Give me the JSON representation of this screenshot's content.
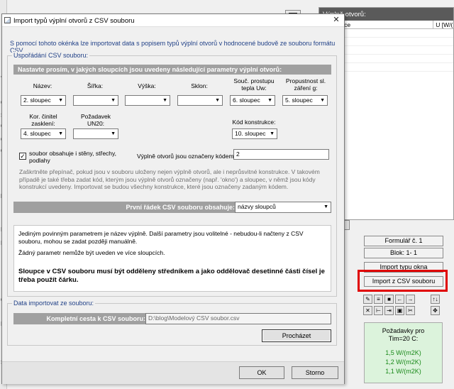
{
  "background": {
    "left_strip_chars": [
      "J",
      "C",
      "S",
      "C",
      "C",
      "C",
      "F",
      "I",
      "I",
      "C",
      "I",
      "S"
    ],
    "right_panel": {
      "title": "Výplně otvorů:",
      "col1": "konstrukce",
      "col2": "U [W/("
    },
    "side_buttons": {
      "formular": "Formulář č. 1",
      "blok": "Blok: 1- 1",
      "import_typu": "Import typu okna",
      "import_csv": "Import z CSV souboru"
    },
    "tools": {
      "row1": [
        "✎",
        "≡",
        "■",
        "←",
        "→",
        "↑↓"
      ],
      "row2": [
        "✕",
        "⊢",
        "⇥",
        "▣",
        "✂",
        "✥"
      ]
    },
    "requirements": {
      "title_line1": "Požadavky pro",
      "title_line2": "Tim=20 C:",
      "values": [
        "1,5 W/(m2K)",
        "1,2 W/(m2K)",
        "1,1 W/(m2K)"
      ],
      "value_color": "#1a8a1a"
    },
    "highlight_color": "#e00000"
  },
  "dialog": {
    "title": "Import typů výplní otvorů z CSV souboru",
    "close_icon": "✕",
    "intro": "S pomocí tohoto okénka lze importovat data s popisem typů výplní otvorů v hodnocené budově ze souboru formátu CSV.",
    "layout_group": {
      "legend": "Uspořádání CSV souboru:",
      "header": "Nastavte prosím, v jakých sloupcích jsou uvedeny následující parametry výplní otvorů:",
      "fields": {
        "nazev": {
          "label": "Název:",
          "value": "2. sloupec"
        },
        "sirka": {
          "label": "Šířka:",
          "value": ""
        },
        "vyska": {
          "label": "Výška:",
          "value": ""
        },
        "sklon": {
          "label": "Sklon:",
          "value": ""
        },
        "uw": {
          "label": "Souč. prostupu tepla Uw:",
          "value": "6. sloupec"
        },
        "g": {
          "label": "Propustnost sl. záření g:",
          "value": "5. sloupec"
        },
        "zaskleni": {
          "label": "Kor. činitel zasklení:",
          "value": "4. sloupec"
        },
        "un20": {
          "label": "Požadavek UN20:",
          "value": ""
        },
        "kod": {
          "label": "Kód konstrukce:",
          "value": "10. sloupec"
        }
      },
      "checkbox_label": "soubor obsahuje i stěny, střechy, podlahy",
      "checkbox_mark": "✓",
      "code_label": "Výplně otvorů jsou označeny kódem:",
      "code_value": "2",
      "gray_note": "Zaškrtněte přepínač, pokud jsou v souboru uloženy nejen výplně otvorů, ale i neprůsvitné konstrukce. V takovém případě je také třeba zadat kód, kterým jsou výplně otvorů označeny (např. 'okno') a sloupec, v němž jsou kódy konstrukcí uvedeny. Importovat se budou všechny konstrukce, které jsou označeny zadaným kódem.",
      "first_row_label": "První řádek CSV souboru obsahuje:",
      "first_row_value": "názvy sloupců",
      "info1": "Jediným povinným parametrem je název výplně. Další parametry jsou volitelné - nebudou-li načteny z CSV souboru, mohou se zadat později manuálně.",
      "info2": "Žádný parametr nemůže být uveden ve více sloupcích.",
      "warning": "Sloupce v CSV souboru musí být odděleny středníkem a jako oddělovač desetinné části čísel je třeba použít čárku."
    },
    "file_group": {
      "legend": "Data importovat ze souboru:",
      "path_label": "Kompletní cesta k CSV souboru:",
      "path_value": "D:\\blog\\Modelový CSV soubor.csv",
      "browse": "Procházet"
    },
    "ok": "OK",
    "cancel": "Storno"
  }
}
